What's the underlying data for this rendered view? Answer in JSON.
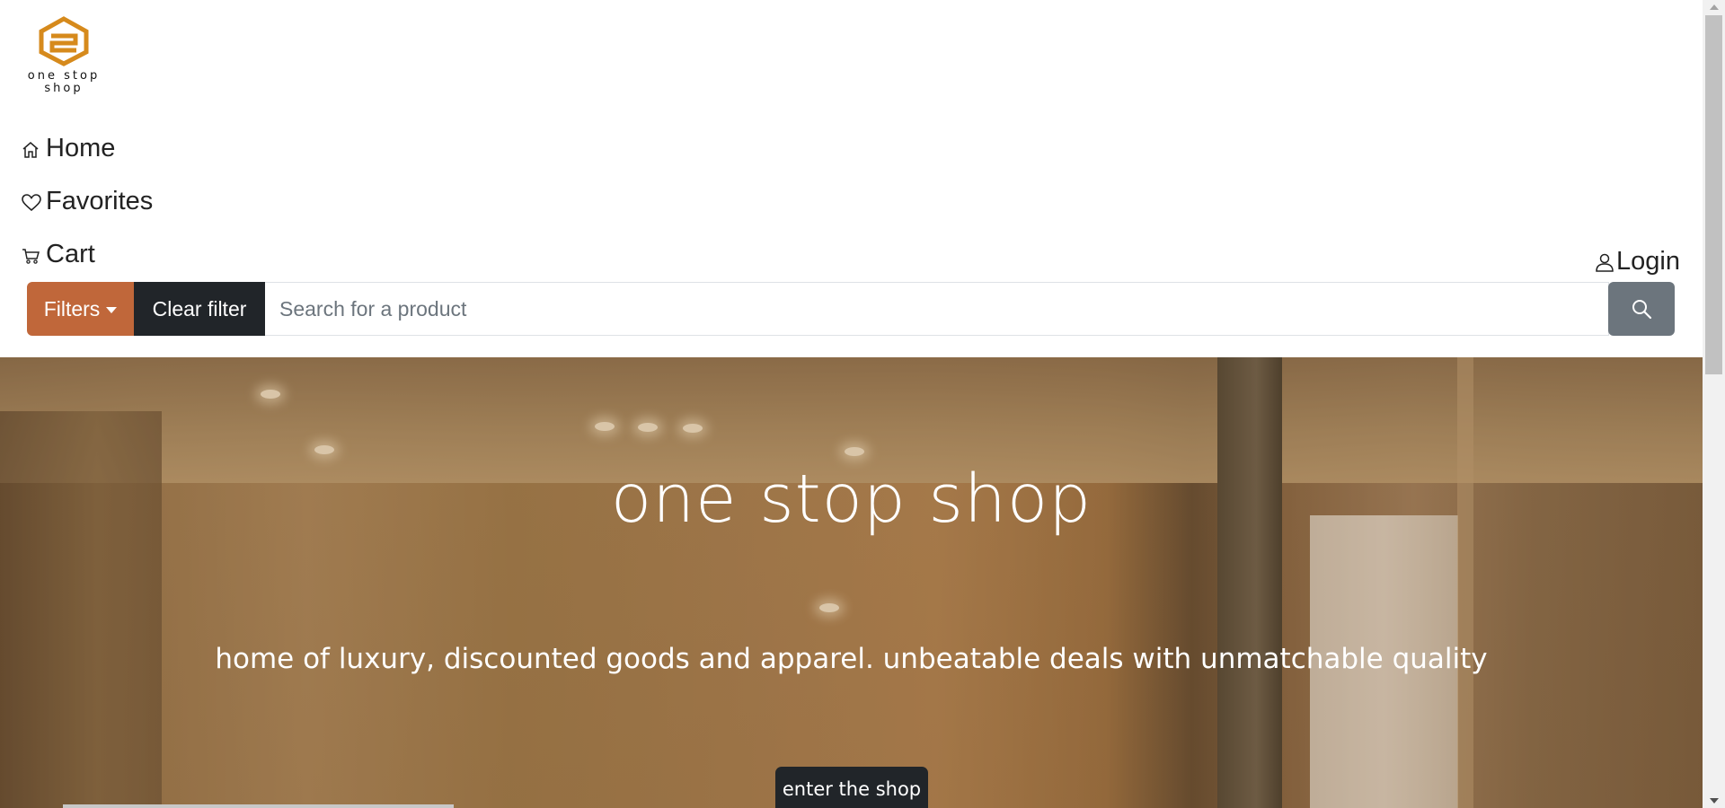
{
  "brand": {
    "logo_text": "one stop shop",
    "accent_color": "#d68a1c"
  },
  "nav": {
    "items": [
      {
        "label": "Home",
        "icon": "house-icon"
      },
      {
        "label": "Favorites",
        "icon": "heart-icon"
      },
      {
        "label": "Cart",
        "icon": "cart-icon"
      }
    ],
    "login_label": "Login",
    "login_icon": "person-icon"
  },
  "search": {
    "filters_label": "Filters",
    "clear_label": "Clear filter",
    "placeholder": "Search for a product",
    "value": "",
    "search_icon": "magnifier-icon",
    "filters_color": "#c0673a",
    "clear_color": "#212529",
    "search_button_color": "#6c757d"
  },
  "hero": {
    "title": "one stop shop",
    "subtitle": "home of luxury, discounted goods and apparel. unbeatable deals with unmatchable quality",
    "cta_label": "enter the shop"
  }
}
